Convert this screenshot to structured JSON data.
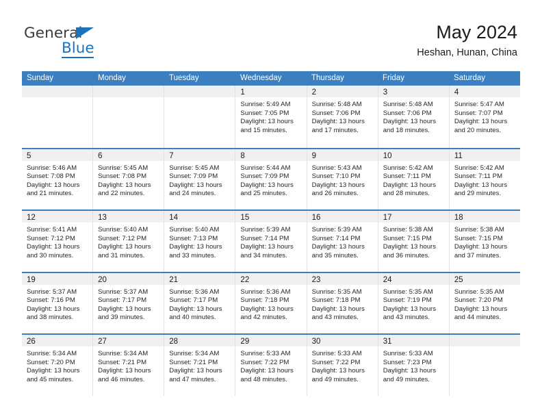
{
  "brand": {
    "name_part1": "General",
    "name_part2": "Blue",
    "triangle_color": "#1c72bb"
  },
  "header": {
    "title": "May 2024",
    "subtitle": "Heshan, Hunan, China"
  },
  "theme": {
    "header_blue": "#3c7fc1",
    "day_head_gray": "#f0f0f0",
    "text": "#1a1a1a"
  },
  "weekdays": [
    "Sunday",
    "Monday",
    "Tuesday",
    "Wednesday",
    "Thursday",
    "Friday",
    "Saturday"
  ],
  "weeks": [
    [
      {
        "day": "",
        "sunrise": "",
        "sunset": "",
        "daylight1": "",
        "daylight2": "",
        "empty": true
      },
      {
        "day": "",
        "sunrise": "",
        "sunset": "",
        "daylight1": "",
        "daylight2": "",
        "empty": true
      },
      {
        "day": "",
        "sunrise": "",
        "sunset": "",
        "daylight1": "",
        "daylight2": "",
        "empty": true
      },
      {
        "day": "1",
        "sunrise": "Sunrise: 5:49 AM",
        "sunset": "Sunset: 7:05 PM",
        "daylight1": "Daylight: 13 hours",
        "daylight2": "and 15 minutes."
      },
      {
        "day": "2",
        "sunrise": "Sunrise: 5:48 AM",
        "sunset": "Sunset: 7:06 PM",
        "daylight1": "Daylight: 13 hours",
        "daylight2": "and 17 minutes."
      },
      {
        "day": "3",
        "sunrise": "Sunrise: 5:48 AM",
        "sunset": "Sunset: 7:06 PM",
        "daylight1": "Daylight: 13 hours",
        "daylight2": "and 18 minutes."
      },
      {
        "day": "4",
        "sunrise": "Sunrise: 5:47 AM",
        "sunset": "Sunset: 7:07 PM",
        "daylight1": "Daylight: 13 hours",
        "daylight2": "and 20 minutes."
      }
    ],
    [
      {
        "day": "5",
        "sunrise": "Sunrise: 5:46 AM",
        "sunset": "Sunset: 7:08 PM",
        "daylight1": "Daylight: 13 hours",
        "daylight2": "and 21 minutes."
      },
      {
        "day": "6",
        "sunrise": "Sunrise: 5:45 AM",
        "sunset": "Sunset: 7:08 PM",
        "daylight1": "Daylight: 13 hours",
        "daylight2": "and 22 minutes."
      },
      {
        "day": "7",
        "sunrise": "Sunrise: 5:45 AM",
        "sunset": "Sunset: 7:09 PM",
        "daylight1": "Daylight: 13 hours",
        "daylight2": "and 24 minutes."
      },
      {
        "day": "8",
        "sunrise": "Sunrise: 5:44 AM",
        "sunset": "Sunset: 7:09 PM",
        "daylight1": "Daylight: 13 hours",
        "daylight2": "and 25 minutes."
      },
      {
        "day": "9",
        "sunrise": "Sunrise: 5:43 AM",
        "sunset": "Sunset: 7:10 PM",
        "daylight1": "Daylight: 13 hours",
        "daylight2": "and 26 minutes."
      },
      {
        "day": "10",
        "sunrise": "Sunrise: 5:42 AM",
        "sunset": "Sunset: 7:11 PM",
        "daylight1": "Daylight: 13 hours",
        "daylight2": "and 28 minutes."
      },
      {
        "day": "11",
        "sunrise": "Sunrise: 5:42 AM",
        "sunset": "Sunset: 7:11 PM",
        "daylight1": "Daylight: 13 hours",
        "daylight2": "and 29 minutes."
      }
    ],
    [
      {
        "day": "12",
        "sunrise": "Sunrise: 5:41 AM",
        "sunset": "Sunset: 7:12 PM",
        "daylight1": "Daylight: 13 hours",
        "daylight2": "and 30 minutes."
      },
      {
        "day": "13",
        "sunrise": "Sunrise: 5:40 AM",
        "sunset": "Sunset: 7:12 PM",
        "daylight1": "Daylight: 13 hours",
        "daylight2": "and 31 minutes."
      },
      {
        "day": "14",
        "sunrise": "Sunrise: 5:40 AM",
        "sunset": "Sunset: 7:13 PM",
        "daylight1": "Daylight: 13 hours",
        "daylight2": "and 33 minutes."
      },
      {
        "day": "15",
        "sunrise": "Sunrise: 5:39 AM",
        "sunset": "Sunset: 7:14 PM",
        "daylight1": "Daylight: 13 hours",
        "daylight2": "and 34 minutes."
      },
      {
        "day": "16",
        "sunrise": "Sunrise: 5:39 AM",
        "sunset": "Sunset: 7:14 PM",
        "daylight1": "Daylight: 13 hours",
        "daylight2": "and 35 minutes."
      },
      {
        "day": "17",
        "sunrise": "Sunrise: 5:38 AM",
        "sunset": "Sunset: 7:15 PM",
        "daylight1": "Daylight: 13 hours",
        "daylight2": "and 36 minutes."
      },
      {
        "day": "18",
        "sunrise": "Sunrise: 5:38 AM",
        "sunset": "Sunset: 7:15 PM",
        "daylight1": "Daylight: 13 hours",
        "daylight2": "and 37 minutes."
      }
    ],
    [
      {
        "day": "19",
        "sunrise": "Sunrise: 5:37 AM",
        "sunset": "Sunset: 7:16 PM",
        "daylight1": "Daylight: 13 hours",
        "daylight2": "and 38 minutes."
      },
      {
        "day": "20",
        "sunrise": "Sunrise: 5:37 AM",
        "sunset": "Sunset: 7:17 PM",
        "daylight1": "Daylight: 13 hours",
        "daylight2": "and 39 minutes."
      },
      {
        "day": "21",
        "sunrise": "Sunrise: 5:36 AM",
        "sunset": "Sunset: 7:17 PM",
        "daylight1": "Daylight: 13 hours",
        "daylight2": "and 40 minutes."
      },
      {
        "day": "22",
        "sunrise": "Sunrise: 5:36 AM",
        "sunset": "Sunset: 7:18 PM",
        "daylight1": "Daylight: 13 hours",
        "daylight2": "and 42 minutes."
      },
      {
        "day": "23",
        "sunrise": "Sunrise: 5:35 AM",
        "sunset": "Sunset: 7:18 PM",
        "daylight1": "Daylight: 13 hours",
        "daylight2": "and 43 minutes."
      },
      {
        "day": "24",
        "sunrise": "Sunrise: 5:35 AM",
        "sunset": "Sunset: 7:19 PM",
        "daylight1": "Daylight: 13 hours",
        "daylight2": "and 43 minutes."
      },
      {
        "day": "25",
        "sunrise": "Sunrise: 5:35 AM",
        "sunset": "Sunset: 7:20 PM",
        "daylight1": "Daylight: 13 hours",
        "daylight2": "and 44 minutes."
      }
    ],
    [
      {
        "day": "26",
        "sunrise": "Sunrise: 5:34 AM",
        "sunset": "Sunset: 7:20 PM",
        "daylight1": "Daylight: 13 hours",
        "daylight2": "and 45 minutes."
      },
      {
        "day": "27",
        "sunrise": "Sunrise: 5:34 AM",
        "sunset": "Sunset: 7:21 PM",
        "daylight1": "Daylight: 13 hours",
        "daylight2": "and 46 minutes."
      },
      {
        "day": "28",
        "sunrise": "Sunrise: 5:34 AM",
        "sunset": "Sunset: 7:21 PM",
        "daylight1": "Daylight: 13 hours",
        "daylight2": "and 47 minutes."
      },
      {
        "day": "29",
        "sunrise": "Sunrise: 5:33 AM",
        "sunset": "Sunset: 7:22 PM",
        "daylight1": "Daylight: 13 hours",
        "daylight2": "and 48 minutes."
      },
      {
        "day": "30",
        "sunrise": "Sunrise: 5:33 AM",
        "sunset": "Sunset: 7:22 PM",
        "daylight1": "Daylight: 13 hours",
        "daylight2": "and 49 minutes."
      },
      {
        "day": "31",
        "sunrise": "Sunrise: 5:33 AM",
        "sunset": "Sunset: 7:23 PM",
        "daylight1": "Daylight: 13 hours",
        "daylight2": "and 49 minutes."
      },
      {
        "day": "",
        "sunrise": "",
        "sunset": "",
        "daylight1": "",
        "daylight2": "",
        "empty": true
      }
    ]
  ]
}
